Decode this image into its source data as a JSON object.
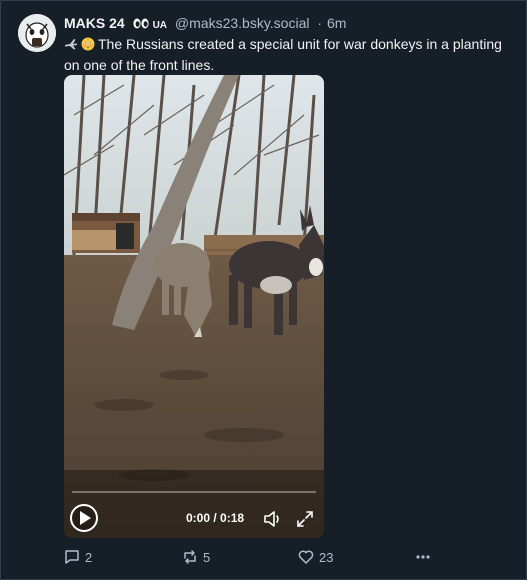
{
  "post": {
    "author": {
      "display_name": "MAKS 24",
      "badge_text": "UA",
      "handle": "@maks23.bsky.social",
      "separator": "·",
      "time_ago": "6m"
    },
    "text": "The Russians created a special unit for war donkeys in a planting on one of the front lines.",
    "leading_icons": [
      "airplane-emoji",
      "flushed-face-emoji"
    ],
    "video": {
      "current_time": "0:00",
      "duration": "0:18",
      "time_display": "0:00 / 0:18",
      "progress_fraction": 0.0
    },
    "actions": {
      "reply_count": "2",
      "repost_count": "5",
      "like_count": "23"
    }
  },
  "colors": {
    "background": "#161e27",
    "text_primary": "#f1f3f5",
    "text_secondary": "#aebbc9",
    "border": "#2e4052"
  }
}
